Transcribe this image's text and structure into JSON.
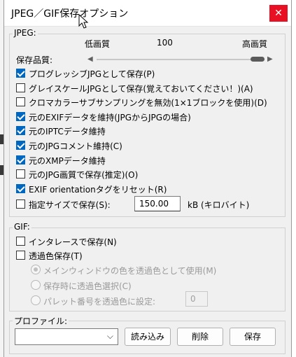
{
  "window": {
    "title": "JPEG／GIF保存オプション",
    "close_label": "✕"
  },
  "jpeg": {
    "group_label": "JPEG:",
    "quality_label": "保存品質:",
    "quality_low": "低画質",
    "quality_high": "高画質",
    "quality_value": "100",
    "options": [
      {
        "label": "プログレッシブJPGとして保存(P)",
        "checked": true
      },
      {
        "label": "グレイスケールJPGとして保存(覚えておいてください！)(A)",
        "checked": false
      },
      {
        "label": "クロマカラーサブサンプリングを無効(1×1ブロックを使用)(D)",
        "checked": false
      },
      {
        "label": "元のEXIFデータを維持(JPGからJPGの場合)",
        "checked": true
      },
      {
        "label": "元のIPTCデータ維持",
        "checked": true
      },
      {
        "label": "元のJPGコメント維持(C)",
        "checked": true
      },
      {
        "label": "元のXMPデータ維持",
        "checked": true
      },
      {
        "label": "元のJPG画質で保存(推定)(O)",
        "checked": false
      },
      {
        "label": "EXIF orientationタグをリセット(R)",
        "checked": true
      }
    ],
    "size_option": {
      "label": "指定サイズで保存(S):",
      "checked": false
    },
    "size_value": "150.00",
    "size_unit": "kB (キロバイト)"
  },
  "gif": {
    "group_label": "GIF:",
    "interlace": {
      "label": "インタレースで保存(N)",
      "checked": false
    },
    "transparent": {
      "label": "透過色保存(T)",
      "checked": false
    },
    "radios": [
      {
        "label": "メインウィンドウの色を透過色として使用(M)",
        "selected": true
      },
      {
        "label": "保存時に透過色選択(C)",
        "selected": false
      },
      {
        "label": "パレット番号を透過色に設定:",
        "selected": false
      }
    ],
    "palette_value": "0"
  },
  "profile": {
    "group_label": "プロファイル:",
    "selected": "",
    "load_label": "読み込み",
    "delete_label": "削除",
    "save_label": "保存"
  },
  "slider": {
    "fraction": 1.0
  },
  "colors": {
    "accent": "#0067c0",
    "close": "#e81123",
    "background": "#f0f0f0"
  }
}
